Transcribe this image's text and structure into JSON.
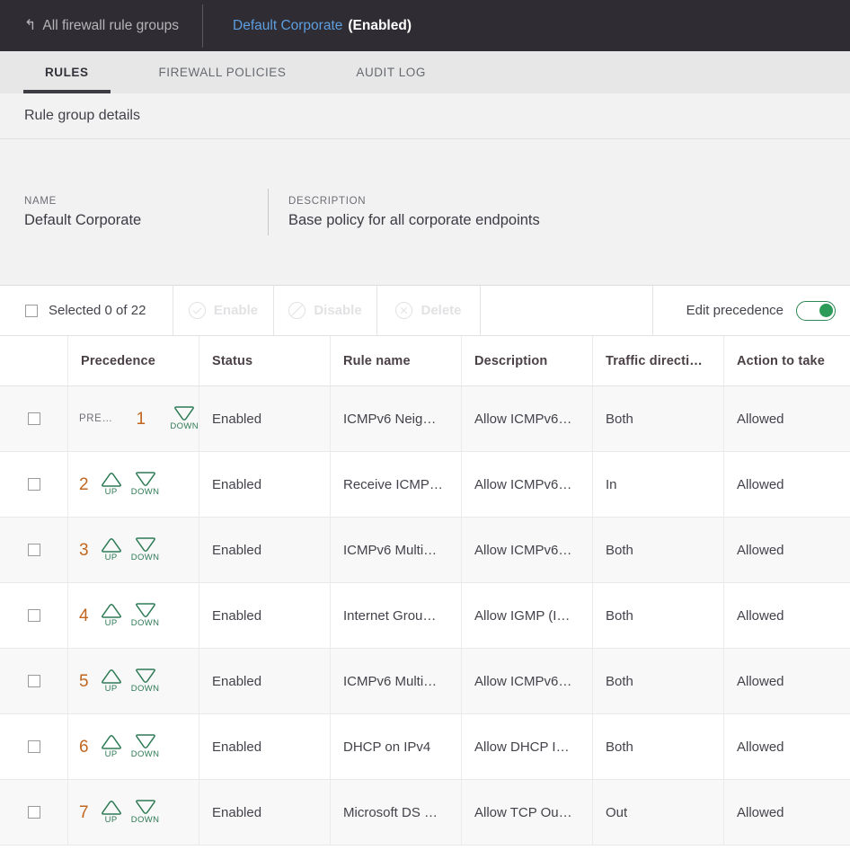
{
  "topbar": {
    "back_icon": "undo-arrow-icon",
    "back_label": "All firewall rule groups",
    "title_name": "Default Corporate",
    "title_state": "(Enabled)"
  },
  "tabs": [
    {
      "label": "RULES",
      "active": true
    },
    {
      "label": "FIREWALL POLICIES",
      "active": false
    },
    {
      "label": "AUDIT LOG",
      "active": false
    }
  ],
  "details": {
    "heading": "Rule group details"
  },
  "info": {
    "name_label": "NAME",
    "name_value": "Default Corporate",
    "description_label": "DESCRIPTION",
    "description_value": "Base policy for all corporate endpoints"
  },
  "toolbar": {
    "selected_label": "Selected 0 of 22",
    "enable_label": "Enable",
    "disable_label": "Disable",
    "delete_label": "Delete",
    "precedence_label": "Edit precedence",
    "precedence_toggle_on": true,
    "enable_icon": "check-circle-icon",
    "disable_icon": "slash-circle-icon",
    "delete_icon": "x-circle-icon"
  },
  "table": {
    "columns": [
      "Precedence",
      "Status",
      "Rule name",
      "Description",
      "Traffic directi…",
      "Action to take"
    ],
    "rows": [
      {
        "precedence": "1",
        "precedence_prefix": "PRE…",
        "up": false,
        "down": true,
        "up_label": "UP",
        "down_label": "DOWN",
        "status": "Enabled",
        "rule_name": "ICMPv6 Neig…",
        "description": "Allow ICMPv6…",
        "direction": "Both",
        "action": "Allowed"
      },
      {
        "precedence": "2",
        "precedence_prefix": "",
        "up": true,
        "down": true,
        "up_label": "UP",
        "down_label": "DOWN",
        "status": "Enabled",
        "rule_name": "Receive ICMP…",
        "description": "Allow ICMPv6…",
        "direction": "In",
        "action": "Allowed"
      },
      {
        "precedence": "3",
        "precedence_prefix": "",
        "up": true,
        "down": true,
        "up_label": "UP",
        "down_label": "DOWN",
        "status": "Enabled",
        "rule_name": "ICMPv6 Multi…",
        "description": "Allow ICMPv6…",
        "direction": "Both",
        "action": "Allowed"
      },
      {
        "precedence": "4",
        "precedence_prefix": "",
        "up": true,
        "down": true,
        "up_label": "UP",
        "down_label": "DOWN",
        "status": "Enabled",
        "rule_name": "Internet Grou…",
        "description": "Allow IGMP (I…",
        "direction": "Both",
        "action": "Allowed"
      },
      {
        "precedence": "5",
        "precedence_prefix": "",
        "up": true,
        "down": true,
        "up_label": "UP",
        "down_label": "DOWN",
        "status": "Enabled",
        "rule_name": "ICMPv6 Multi…",
        "description": "Allow ICMPv6…",
        "direction": "Both",
        "action": "Allowed"
      },
      {
        "precedence": "6",
        "precedence_prefix": "",
        "up": true,
        "down": true,
        "up_label": "UP",
        "down_label": "DOWN",
        "status": "Enabled",
        "rule_name": "DHCP on IPv4",
        "description": "Allow DHCP I…",
        "direction": "Both",
        "action": "Allowed"
      },
      {
        "precedence": "7",
        "precedence_prefix": "",
        "up": true,
        "down": true,
        "up_label": "UP",
        "down_label": "DOWN",
        "status": "Enabled",
        "rule_name": "Microsoft DS …",
        "description": "Allow TCP Ou…",
        "direction": "Out",
        "action": "Allowed"
      }
    ]
  },
  "colors": {
    "topbar_bg": "#2f2d33",
    "link_blue": "#5c9ee0",
    "accent_green": "#2e8555",
    "precedence_orange": "#c1661f",
    "tab_bg": "#e7e7e7",
    "panel_bg": "#f2f2f2",
    "row_alt_bg": "#f8f8f8"
  }
}
